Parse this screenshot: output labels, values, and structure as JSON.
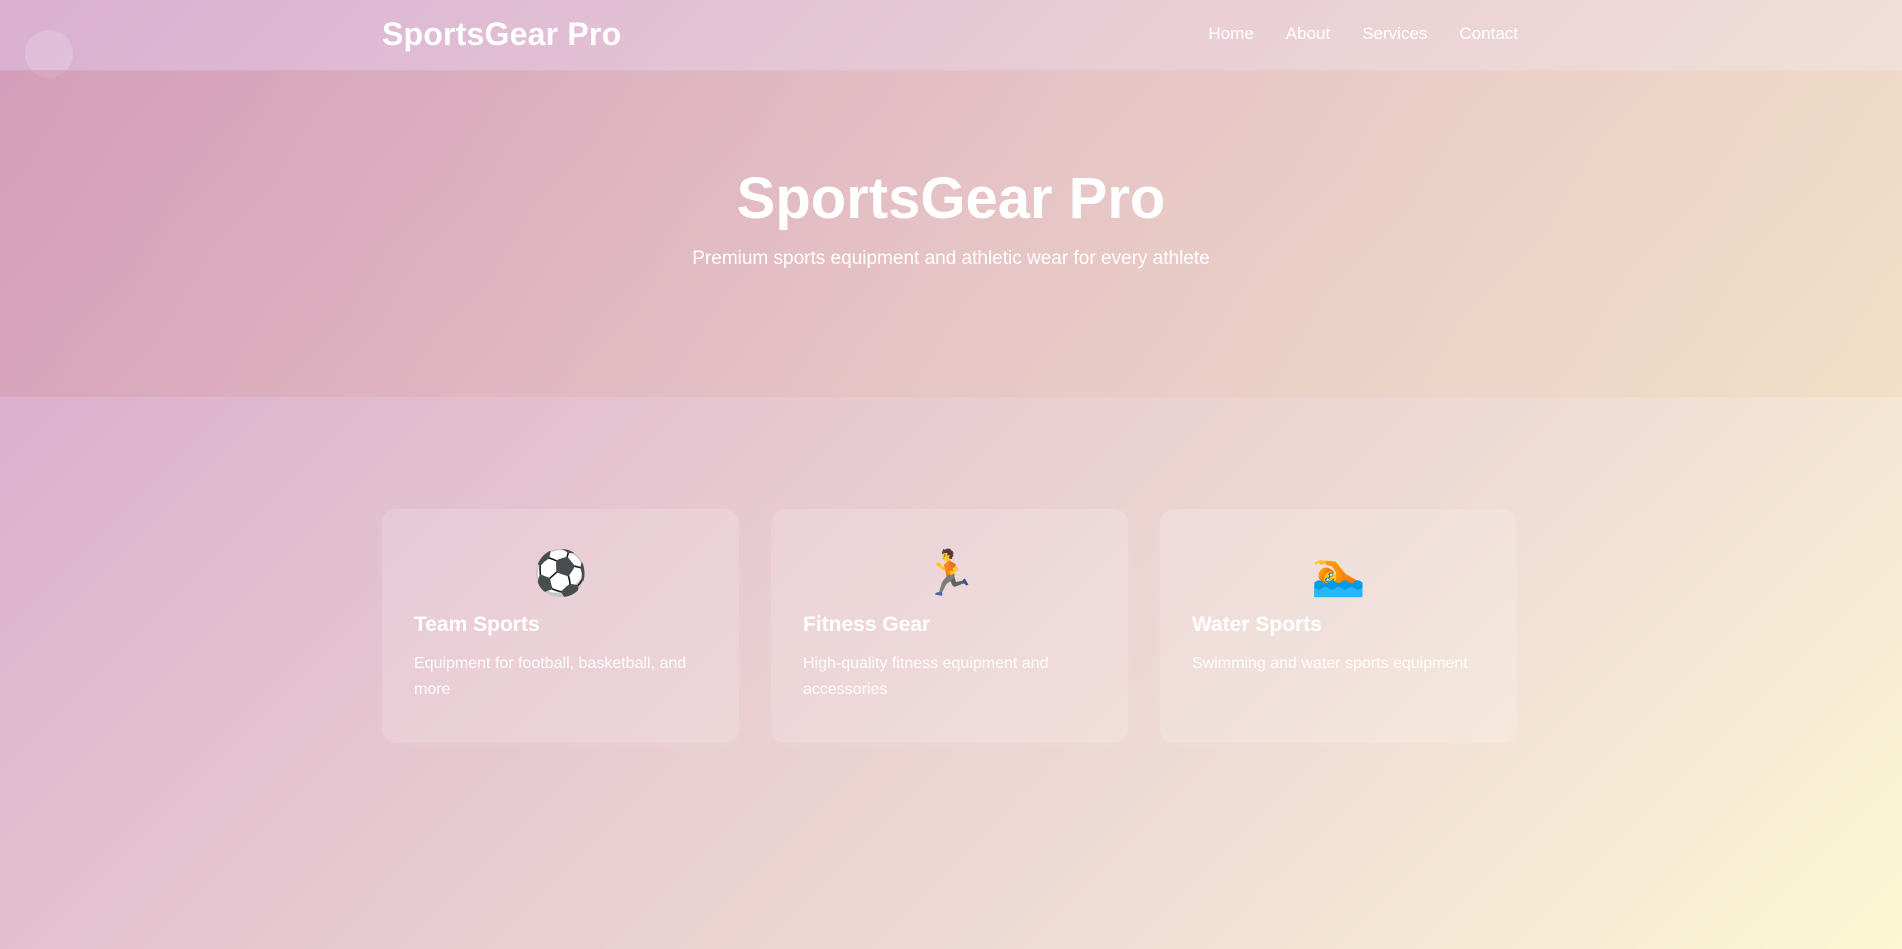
{
  "header": {
    "brand": "SportsGear Pro",
    "nav": [
      "Home",
      "About",
      "Services",
      "Contact"
    ]
  },
  "hero": {
    "title": "SportsGear Pro",
    "subtitle": "Premium sports equipment and athletic wear for every athlete"
  },
  "cards": [
    {
      "icon": "⚽",
      "icon_name": "soccer-ball-icon",
      "title": "Team Sports",
      "description": "Equipment for football, basketball, and more"
    },
    {
      "icon": "🏃",
      "icon_name": "running-person-icon",
      "title": "Fitness Gear",
      "description": "High-quality fitness equipment and accessories"
    },
    {
      "icon": "🏊",
      "icon_name": "swimmer-icon",
      "title": "Water Sports",
      "description": "Swimming and water sports equipment"
    }
  ],
  "colors": {
    "background_start": "#d4a5cc",
    "background_end": "#fcf7d4",
    "text": "#ffffff"
  }
}
